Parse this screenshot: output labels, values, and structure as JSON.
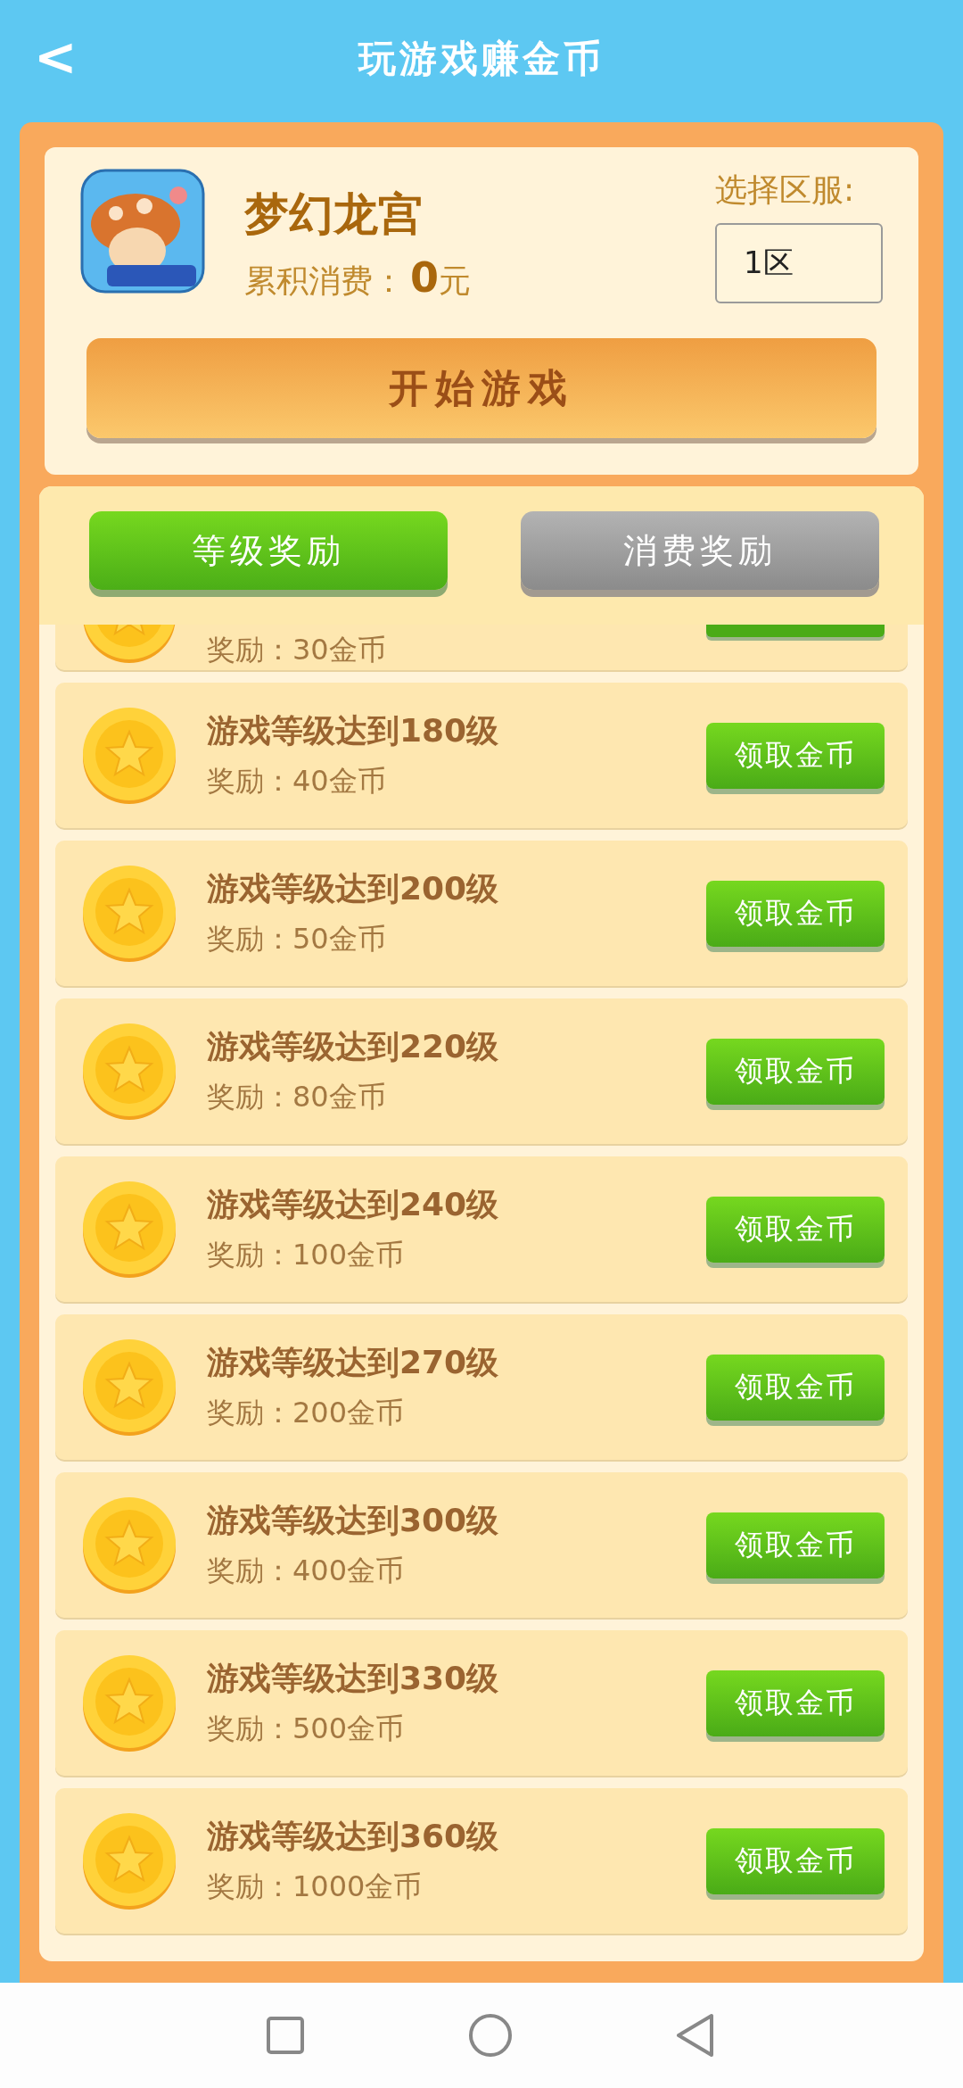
{
  "header": {
    "back": "<",
    "title": "玩游戏赚金币"
  },
  "game": {
    "name": "梦幻龙宫",
    "spend_label": "累积消费：",
    "spend_amount": "0",
    "spend_unit": "元",
    "server_label": "选择区服:",
    "server_value": "1区",
    "start_button": "开始游戏"
  },
  "tabs": [
    {
      "label": "等级奖励",
      "selected": true
    },
    {
      "label": "消费奖励",
      "selected": false
    }
  ],
  "rewards": [
    {
      "kind": "partial",
      "reward": "奖励：30金币"
    },
    {
      "kind": "full",
      "title": "游戏等级达到180级",
      "reward": "奖励：40金币",
      "button": "领取金币"
    },
    {
      "kind": "full",
      "title": "游戏等级达到200级",
      "reward": "奖励：50金币",
      "button": "领取金币"
    },
    {
      "kind": "full",
      "title": "游戏等级达到220级",
      "reward": "奖励：80金币",
      "button": "领取金币"
    },
    {
      "kind": "full",
      "title": "游戏等级达到240级",
      "reward": "奖励：100金币",
      "button": "领取金币"
    },
    {
      "kind": "full",
      "title": "游戏等级达到270级",
      "reward": "奖励：200金币",
      "button": "领取金币"
    },
    {
      "kind": "full",
      "title": "游戏等级达到300级",
      "reward": "奖励：400金币",
      "button": "领取金币"
    },
    {
      "kind": "full",
      "title": "游戏等级达到330级",
      "reward": "奖励：500金币",
      "button": "领取金币"
    },
    {
      "kind": "full",
      "title": "游戏等级达到360级",
      "reward": "奖励：1000金币",
      "button": "领取金币"
    }
  ]
}
